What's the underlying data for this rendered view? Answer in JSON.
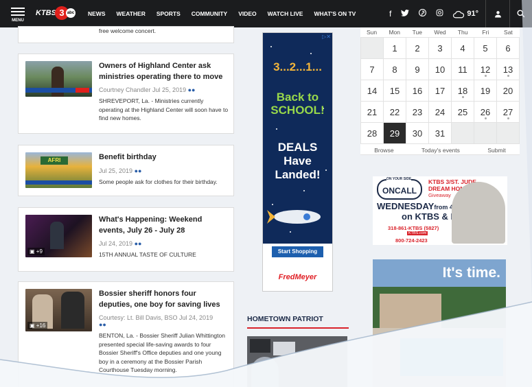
{
  "nav": {
    "menu_label": "MENU",
    "logo_text": "KTBS",
    "logo_channel": "3",
    "logo_network": "abc",
    "items": [
      "NEWS",
      "WEATHER",
      "SPORTS",
      "COMMUNITY",
      "VIDEO",
      "WATCH LIVE",
      "WHAT'S ON TV"
    ],
    "social_icons": [
      "facebook-icon",
      "twitter-icon",
      "pinterest-icon",
      "instagram-icon"
    ],
    "weather_temp": "91°",
    "accent_color": "#d9222a"
  },
  "top_snippet": "free welcome concert.",
  "articles": [
    {
      "title": "Owners of Highland Center ask ministries operating there to move",
      "meta": "Courtney Chandler  Jul 25, 2019",
      "desc": "SHREVEPORT, La. - Ministries currently operating at the Highland Center will soon have to find new homes."
    },
    {
      "title": "Benefit birthday",
      "meta": "Jul 25, 2019",
      "desc": "Some people ask for clothes for their birthday."
    },
    {
      "title": "What's Happening: Weekend events, July 26 - July 28",
      "meta": "Jul 24, 2019",
      "desc": "15TH ANNUAL TASTE OF CULTURE",
      "badge": "+9"
    },
    {
      "title": "Bossier sheriff honors four deputies, one boy for saving lives",
      "meta": "Courtesy: Lt. Bill Davis, BSO  Jul 24, 2019",
      "desc": "BENTON, La. - Bossier Sheriff Julian Whittington presented special life-saving awards to four Bossier Sheriff's Office deputies and one young boy in a ceremony at the Bossier Parish Courthouse Tuesday morning.",
      "badge": "+16"
    }
  ],
  "ad": {
    "countdown": "3...2...1...",
    "line1": "Back to SCHOOL!",
    "line2": "DEALS Have Landed!",
    "button": "Start Shopping",
    "brand": "FredMeyer"
  },
  "hometown": {
    "title": "HOMETOWN PATRIOT"
  },
  "calendar": {
    "days": [
      "Sun",
      "Mon",
      "Tue",
      "Wed",
      "Thu",
      "Fri",
      "Sat"
    ],
    "cells": [
      "",
      "1",
      "2",
      "3",
      "4",
      "5",
      "6",
      "7",
      "8",
      "9",
      "10",
      "11",
      "12",
      "13",
      "14",
      "15",
      "16",
      "17",
      "18",
      "19",
      "20",
      "21",
      "22",
      "23",
      "24",
      "25",
      "26",
      "27",
      "28",
      "29",
      "30",
      "31",
      "",
      "",
      ""
    ],
    "dots": [
      "12",
      "13",
      "18",
      "26",
      "27"
    ],
    "selected": "29",
    "footer": [
      "Browse",
      "Today's events",
      "Submit"
    ]
  },
  "promo": {
    "oys": "ONCALL",
    "oys_top": "ON YOUR SIDE",
    "title": "KTBS 3/ST. JUDE DREAM HOME",
    "giveaway": "Giveaway",
    "wed": "WEDNESDAY",
    "times": "from 4p to 7p",
    "on": "on KTBS & KPXJ",
    "phone1": "318-861-KTBS (5827)",
    "site": "KTBS.com",
    "phone2": "800-724-2423"
  },
  "timead": {
    "title": "It's time."
  }
}
